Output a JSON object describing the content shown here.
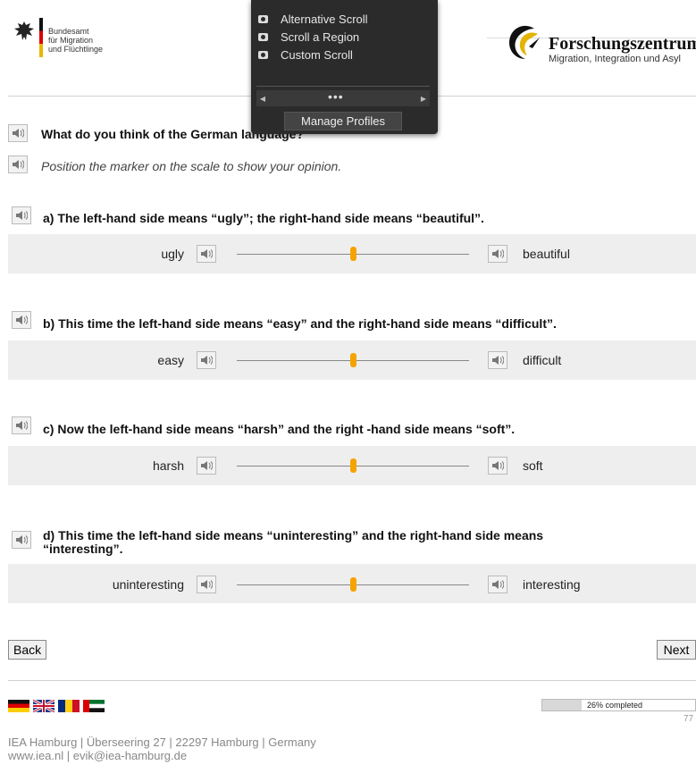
{
  "header": {
    "bamf_text": "Bundesamt\nfür Migration\nund Flüchtlinge",
    "fz_title": "Forschungszentrum",
    "fz_subtitle": "Migration, Integration und Asyl"
  },
  "question": "What do you think of the German language?",
  "instruction": "Position the marker on the scale to show your opinion.",
  "items": [
    {
      "prompt": "a) The left-hand side means “ugly”; the right-hand side means “beautiful”.",
      "left": "ugly",
      "right": "beautiful",
      "value": 0.5
    },
    {
      "prompt": "b) This time the left-hand side means “easy” and the right-hand side means “difficult”.",
      "left": "easy",
      "right": "difficult",
      "value": 0.5
    },
    {
      "prompt": "c) Now the left-hand side means “harsh” and the right -hand side means “soft”.",
      "left": "harsh",
      "right": "soft",
      "value": 0.5
    },
    {
      "prompt_line1": "d) This time the left-hand side means “uninteresting” and the right-hand side means",
      "prompt_line2": "“interesting”.",
      "left": "uninteresting",
      "right": "interesting",
      "value": 0.5
    }
  ],
  "nav": {
    "back": "Back",
    "next": "Next"
  },
  "progress": {
    "text": "26% completed",
    "fraction": 0.26,
    "page": "77"
  },
  "footer": {
    "line1": "IEA Hamburg | Überseering 27 | 22297 Hamburg | Germany",
    "line2": "www.iea.nl | evik@iea-hamburg.de"
  },
  "flags": [
    "flag-germany-icon",
    "flag-uk-icon",
    "flag-romania-icon",
    "flag-uae-icon"
  ],
  "popup": {
    "items": [
      "Alternative Scroll",
      "Scroll a Region",
      "Custom Scroll"
    ],
    "dots": "•••",
    "manage": "Manage Profiles"
  },
  "colors": {
    "thumb": "#f5a300",
    "band": "#eeeeee"
  }
}
